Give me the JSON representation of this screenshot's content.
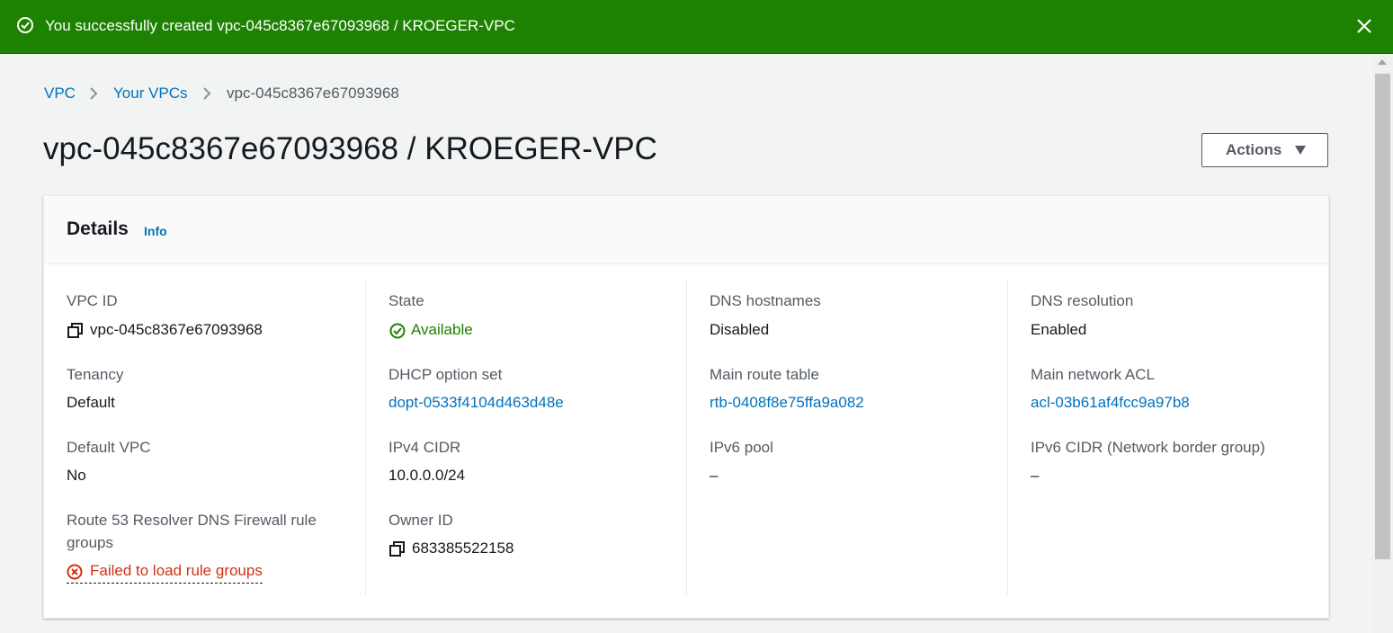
{
  "flash": {
    "message": "You successfully created vpc-045c8367e67093968 / KROEGER-VPC",
    "type": "success"
  },
  "breadcrumb": {
    "items": [
      "VPC",
      "Your VPCs"
    ],
    "current": "vpc-045c8367e67093968"
  },
  "page": {
    "title": "vpc-045c8367e67093968 / KROEGER-VPC",
    "actions_label": "Actions"
  },
  "details": {
    "title": "Details",
    "info_label": "Info",
    "fields": {
      "vpc_id": {
        "label": "VPC ID",
        "value": "vpc-045c8367e67093968"
      },
      "state": {
        "label": "State",
        "value": "Available"
      },
      "dns_hostnames": {
        "label": "DNS hostnames",
        "value": "Disabled"
      },
      "dns_resolution": {
        "label": "DNS resolution",
        "value": "Enabled"
      },
      "tenancy": {
        "label": "Tenancy",
        "value": "Default"
      },
      "dhcp_option_set": {
        "label": "DHCP option set",
        "value": "dopt-0533f4104d463d48e"
      },
      "main_route_table": {
        "label": "Main route table",
        "value": "rtb-0408f8e75ffa9a082"
      },
      "main_network_acl": {
        "label": "Main network ACL",
        "value": "acl-03b61af4fcc9a97b8"
      },
      "default_vpc": {
        "label": "Default VPC",
        "value": "No"
      },
      "ipv4_cidr": {
        "label": "IPv4 CIDR",
        "value": "10.0.0.0/24"
      },
      "ipv6_pool": {
        "label": "IPv6 pool",
        "value": "–"
      },
      "ipv6_cidr": {
        "label": "IPv6 CIDR (Network border group)",
        "value": "–"
      },
      "route53_firewall": {
        "label_line1": "Route 53 Resolver DNS Firewall rule",
        "label_line2": "groups",
        "value": "Failed to load rule groups"
      },
      "owner_id": {
        "label": "Owner ID",
        "value": "683385522158"
      }
    }
  },
  "colors": {
    "success_green": "#1d8102",
    "link_blue": "#0073bb",
    "error_red": "#d13212",
    "label_grey": "#545b64",
    "text_dark": "#16191f"
  },
  "icons": {
    "flash": "success-circle-check-icon",
    "close": "close-x-icon",
    "copy": "copy-icon",
    "status_ok": "status-available-icon",
    "status_error": "status-error-icon",
    "breadcrumb_separator": "chevron-right-icon",
    "actions_caret": "caret-down-icon"
  }
}
